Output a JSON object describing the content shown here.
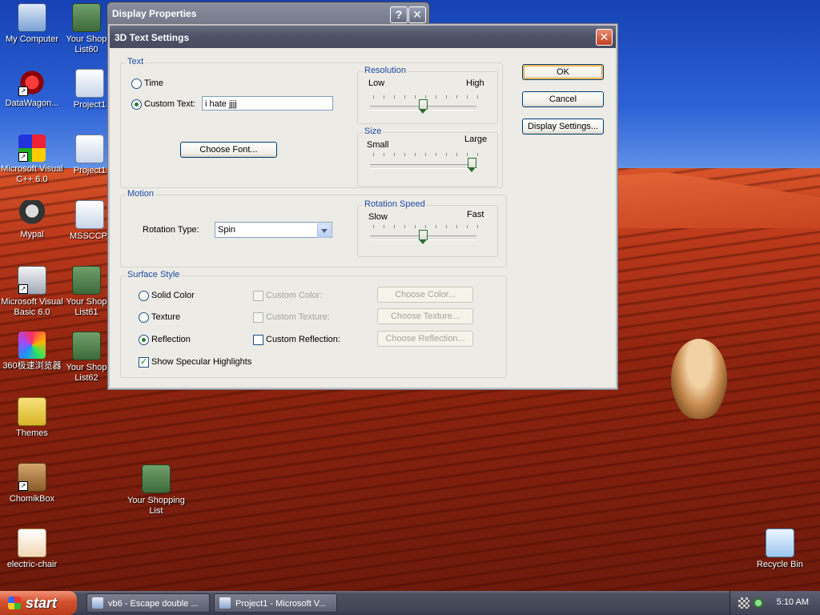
{
  "desktop": {
    "icons": [
      {
        "id": "my-computer",
        "label": "My Computer",
        "icon": "computer-icon"
      },
      {
        "id": "your-shop-list60",
        "label": "Your Shop List60",
        "icon": "shop-icon"
      },
      {
        "id": "datawagon",
        "label": "DataWagon...",
        "icon": "datawagon-icon"
      },
      {
        "id": "project1-a",
        "label": "Project1",
        "icon": "project-icon"
      },
      {
        "id": "msvc",
        "label": "Microsoft Visual C++ 6.0",
        "icon": "vc-icon"
      },
      {
        "id": "project1-b",
        "label": "Project1",
        "icon": "project-icon"
      },
      {
        "id": "mypal",
        "label": "Mypal",
        "icon": "mypal-icon"
      },
      {
        "id": "msccpi",
        "label": "MSSCCPI",
        "icon": "project-icon"
      },
      {
        "id": "msvb",
        "label": "Microsoft Visual Basic 6.0",
        "icon": "vb-icon"
      },
      {
        "id": "your-shop-list61",
        "label": "Your Shop List61",
        "icon": "shop-icon"
      },
      {
        "id": "browser360",
        "label": "360极速浏览器",
        "icon": "browser-360-icon"
      },
      {
        "id": "your-shop-list62",
        "label": "Your Shop List62",
        "icon": "shop-icon"
      },
      {
        "id": "themes",
        "label": "Themes",
        "icon": "themes-icon"
      },
      {
        "id": "chomikbox",
        "label": "ChomikBox",
        "icon": "chomikbox-icon"
      },
      {
        "id": "your-shopping-list",
        "label": "Your Shopping List",
        "icon": "shop-icon"
      },
      {
        "id": "electric-chair",
        "label": "electric-chair",
        "icon": "document-icon"
      },
      {
        "id": "recycle-bin",
        "label": "Recycle Bin",
        "icon": "recycle-bin-icon"
      }
    ]
  },
  "display_properties": {
    "title": "Display Properties",
    "help_glyph": "?",
    "close_glyph": "✕"
  },
  "dialog": {
    "title": "3D Text Settings",
    "close_glyph": "✕",
    "text_group": {
      "title": "Text",
      "time_label": "Time",
      "custom_text_label": "Custom Text:",
      "custom_text_value": "i hate jjjj",
      "selected": "custom_text",
      "choose_font_button": "Choose Font..."
    },
    "resolution": {
      "title": "Resolution",
      "low": "Low",
      "high": "High",
      "level": 0.5
    },
    "size": {
      "title": "Size",
      "small": "Small",
      "large": "Large",
      "level": 1.0
    },
    "motion": {
      "title": "Motion",
      "rotation_type_label": "Rotation Type:",
      "rotation_type_value": "Spin"
    },
    "rotation_speed": {
      "title": "Rotation Speed",
      "slow": "Slow",
      "fast": "Fast",
      "level": 0.5
    },
    "surface": {
      "title": "Surface Style",
      "solid_color": "Solid Color",
      "texture": "Texture",
      "reflection": "Reflection",
      "selected": "reflection",
      "custom_color": "Custom Color:",
      "custom_texture": "Custom Texture:",
      "custom_reflection": "Custom Reflection:",
      "choose_color": "Choose Color...",
      "choose_texture": "Choose Texture...",
      "choose_reflection": "Choose Reflection...",
      "show_specular": "Show Specular Highlights",
      "show_specular_checked": true
    },
    "buttons": {
      "ok": "OK",
      "cancel": "Cancel",
      "display_settings": "Display Settings..."
    }
  },
  "taskbar": {
    "start_label": "start",
    "tasks": [
      {
        "label": "vb6 - Escape double ..."
      },
      {
        "label": "Project1 - Microsoft V..."
      }
    ],
    "clock": "5:10 AM"
  }
}
